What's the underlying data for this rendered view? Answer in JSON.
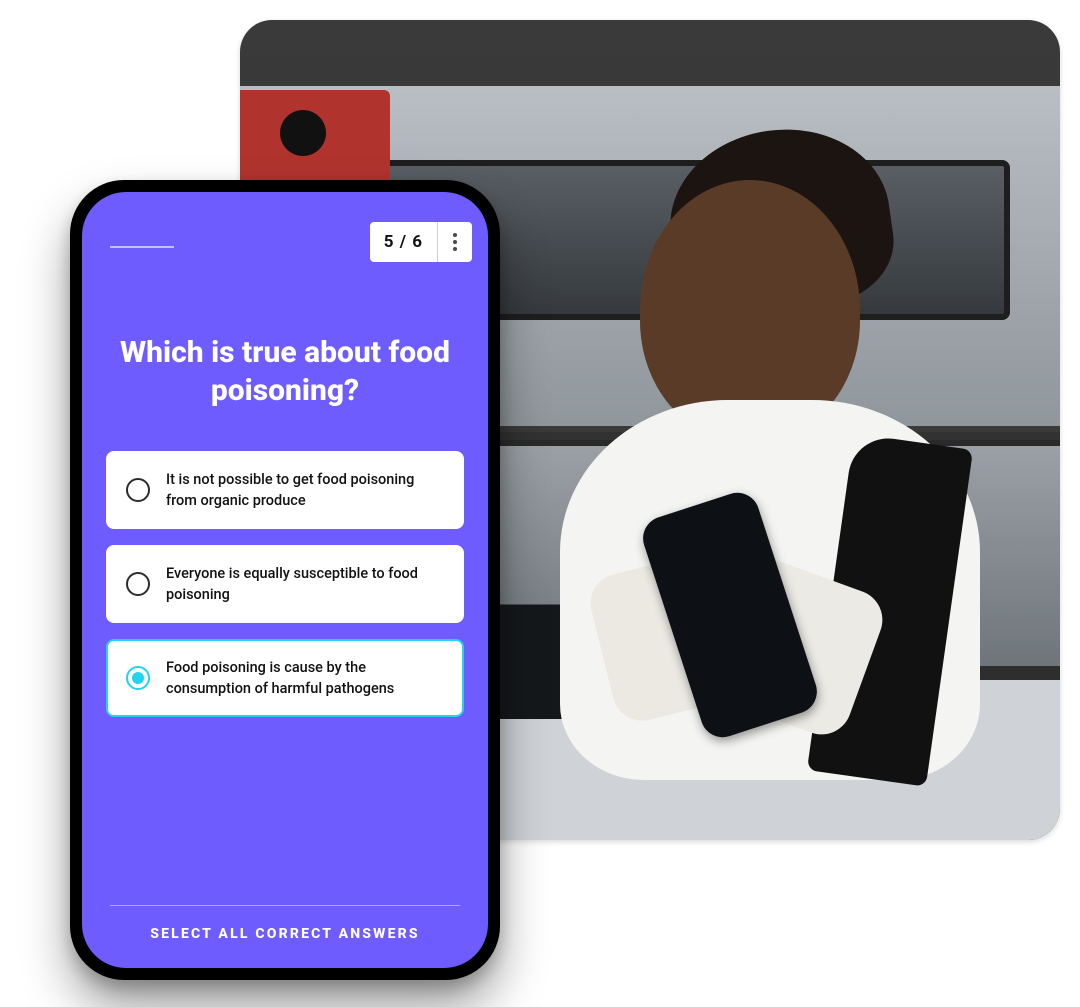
{
  "colors": {
    "accent": "#6f5cff",
    "selected_border": "#22d3ee"
  },
  "quiz": {
    "progress_label": "5 / 6",
    "question": "Which is true about food poisoning?",
    "hint": "SELECT ALL CORRECT ANSWERS",
    "answers": [
      {
        "text": "It is not possible to get food poisoning from organic produce",
        "selected": false
      },
      {
        "text": "Everyone is equally susceptible to food poisoning",
        "selected": false
      },
      {
        "text": "Food poisoning is cause by the consumption of harmful pathogens",
        "selected": true
      }
    ]
  },
  "background_photo": {
    "description": "Kitchen worker in white t-shirt and black apron, wearing gloves, smiling while looking at a smartphone in front of commercial pizza ovens"
  }
}
